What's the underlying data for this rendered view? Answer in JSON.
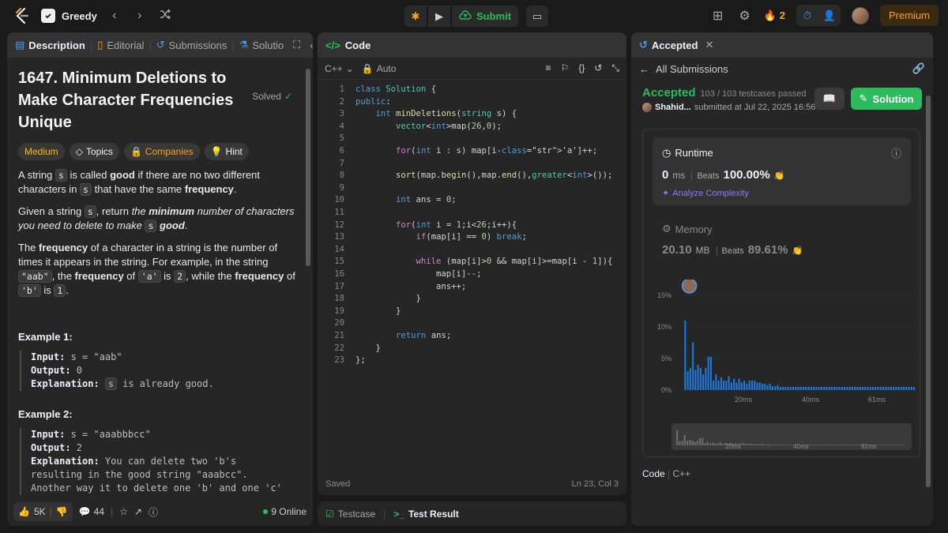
{
  "topbar": {
    "problem_list": "Greedy",
    "submit_label": "Submit",
    "streak": "2",
    "premium_label": "Premium"
  },
  "left": {
    "tabs": [
      "Description",
      "Editorial",
      "Submissions",
      "Solutio"
    ],
    "title": "1647. Minimum Deletions to Make Character Frequencies Unique",
    "solved": "Solved",
    "tags": [
      "Medium",
      "Topics",
      "Companies",
      "Hint"
    ],
    "p1": {
      "a": "A string ",
      "s": "s",
      "b": " is called ",
      "good": "good",
      "c": " if there are no two different characters in ",
      "s2": "s",
      "d": " that have the same ",
      "freq": "frequency",
      "e": "."
    },
    "p2": {
      "a": "Given a string ",
      "s": "s",
      "b": ", return ",
      "the": "the ",
      "min": "minimum",
      "c": " number of characters you need to delete to make ",
      "s2": "s",
      "good": " good",
      "d": "."
    },
    "p3": {
      "the": "The ",
      "freq": "frequency",
      "a": " of a character in a string is the number of times it appears in the string. For example, in the string ",
      "aab": "\"aab\"",
      "b": ", the ",
      "freq2": "frequency",
      "c": " of ",
      "ca": "'a'",
      "d": " is ",
      "two": "2",
      "e": ", while the ",
      "freq3": "frequency",
      "f": " of ",
      "cb": "'b'",
      "g": " is ",
      "one": "1",
      "h": "."
    },
    "ex1": {
      "title": "Example 1:",
      "input_k": "Input:",
      "input_v": " s = \"aab\"",
      "output_k": "Output:",
      "output_v": " 0",
      "expl_k": "Explanation:",
      "expl_s": "s",
      "expl_v": " is already good."
    },
    "ex2": {
      "title": "Example 2:",
      "input_k": "Input:",
      "input_v": " s = \"aaabbbcc\"",
      "output_k": "Output:",
      "output_v": " 2",
      "expl_k": "Explanation:",
      "expl_v1": " You can delete two 'b's",
      "expl_v2": "resulting in the good string \"aaabcc\".",
      "expl_v3": "Another way it to delete one 'b' and one 'c'"
    },
    "footer": {
      "likes": "5K",
      "comments": "44",
      "online": "9 Online"
    }
  },
  "code": {
    "title": "Code",
    "language": "C++",
    "mode": "Auto",
    "status": "Saved",
    "cursor": "Ln 23, Col 3",
    "lines": [
      "class Solution {",
      "public:",
      "    int minDeletions(string s) {",
      "        vector<int>map(26,0);",
      "",
      "        for(int i : s) map[i-'a']++;",
      "",
      "        sort(map.begin(),map.end(),greater<int>());",
      "",
      "        int ans = 0;",
      "",
      "        for(int i = 1;i<26;i++){",
      "            if(map[i] == 0) break;",
      "",
      "            while (map[i]>0 && map[i]>=map[i - 1]){",
      "                map[i]--;",
      "                ans++;",
      "            }",
      "        }",
      "",
      "        return ans;",
      "    }",
      "};"
    ]
  },
  "testbar": {
    "testcase": "Testcase",
    "result": "Test Result"
  },
  "right": {
    "tab": "Accepted",
    "back": "All Submissions",
    "status": "Accepted",
    "testcases": "103 / 103 testcases passed",
    "user": "Shahid...",
    "submitted": "submitted at Jul 22, 2025 16:56",
    "solution_btn": "Solution",
    "runtime": {
      "label": "Runtime",
      "value": "0",
      "unit": "ms",
      "beats_label": "Beats",
      "beats": "100.00%",
      "analyze": "Analyze Complexity"
    },
    "memory": {
      "label": "Memory",
      "value": "20.10",
      "unit": "MB",
      "beats_label": "Beats",
      "beats": "89.61%"
    },
    "code_label": "Code",
    "code_lang": "C++"
  },
  "chart_data": {
    "type": "bar",
    "title": "",
    "ylabel": "",
    "xlabel": "",
    "y_ticks": [
      "15%",
      "10%",
      "5%",
      "0%"
    ],
    "x_ticks": [
      "20ms",
      "40ms",
      "61ms"
    ],
    "ylim": [
      0,
      15
    ],
    "values": [
      11,
      3,
      3.5,
      7.5,
      3.2,
      4,
      3.5,
      2.5,
      3.5,
      5.3,
      5.3,
      1.5,
      2.5,
      1.5,
      2,
      1.5,
      1.5,
      2.2,
      1.2,
      1.8,
      1.2,
      1.8,
      1.2,
      1.5,
      1,
      1.5,
      1.5,
      1.5,
      1.2,
      1.2,
      1,
      1,
      0.8,
      1,
      0.6,
      0.6,
      0.8,
      0.5,
      0.5,
      0.5,
      0.5,
      0.5,
      0.5,
      0.5,
      0.5,
      0.5,
      0.5,
      0.5,
      0.5,
      0.5,
      0.5,
      0.5,
      0.5,
      0.5,
      0.5,
      0.5,
      0.5,
      0.5,
      0.5,
      0.5,
      0.5,
      0.5,
      0.5,
      0.5,
      0.5,
      0.5,
      0.5,
      0.5,
      0.5,
      0.5,
      0.5,
      0.5,
      0.5,
      0.5,
      0.5,
      0.5,
      0.5,
      0.5,
      0.5,
      0.5,
      0.5,
      0.5,
      0.5,
      0.5,
      0.5,
      0.5,
      0.5,
      0.5,
      0.5,
      0.5
    ],
    "colors": {
      "bar": "#1f7ae0",
      "highlight": "#2d8cf0"
    },
    "grid": true
  }
}
